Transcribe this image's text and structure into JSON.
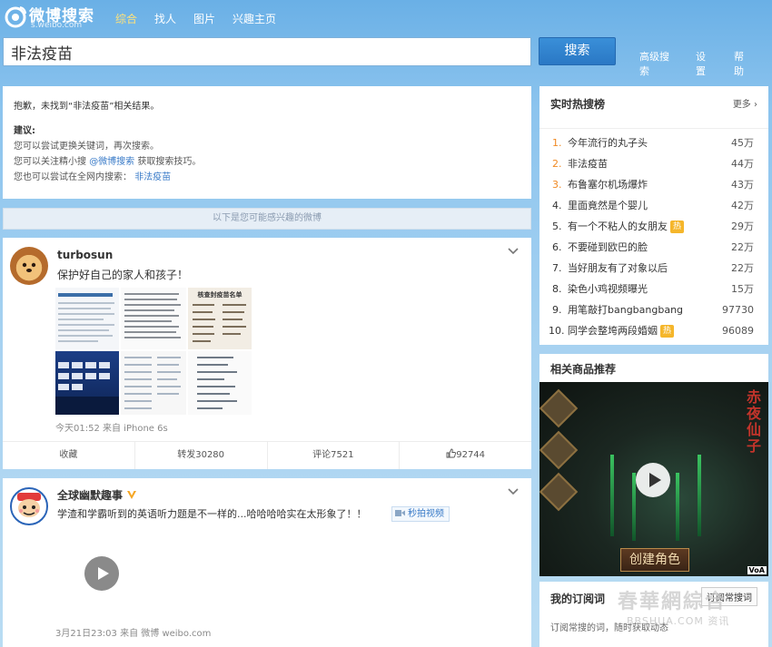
{
  "header": {
    "logo_text": "微博搜索",
    "logo_sub": "s.weibo.com",
    "tabs": [
      {
        "label": "综合",
        "active": true
      },
      {
        "label": "找人"
      },
      {
        "label": "图片"
      },
      {
        "label": "兴趣主页"
      }
    ],
    "search_value": "非法疫苗",
    "search_button": "搜索",
    "links": [
      "高级搜索",
      "设置",
      "帮助"
    ]
  },
  "no_result": {
    "line1_a": "抱歉，未找到“",
    "line1_q": "非法疫苗",
    "line1_b": "”相关结果。",
    "suggest_title": "建议:",
    "s1": "您可以尝试更换关键词，再次搜索。",
    "s2_a": "您可以关注精小搜",
    "s2_link": "@微博搜索",
    "s2_b": "获取搜索技巧。",
    "s3_a": "您也可以尝试在全网内搜索：",
    "s3_link": "非法疫苗"
  },
  "divider": "以下是您可能感兴趣的微博",
  "post1": {
    "user": "turbosun",
    "text": "保护好自己的家人和孩子！",
    "image_heading": "核查封疫苗名单",
    "meta": "今天01:52 来自 iPhone 6s",
    "actions": [
      "收藏",
      "转发30280",
      "评论7521",
      "92744"
    ]
  },
  "post2": {
    "user": "全球幽默趣事",
    "text": "学渣和学霸听到的英语听力题是不一样的...哈哈哈哈实在太形象了！！",
    "tag": "秒拍视频",
    "meta": "3月21日23:03 来自 微博 weibo.com"
  },
  "hot": {
    "title": "实时热搜榜",
    "more": "更多",
    "badge": "热",
    "items": [
      {
        "rank": "1.",
        "kw": "今年流行的丸子头",
        "cnt": "45万"
      },
      {
        "rank": "2.",
        "kw": "非法疫苗",
        "cnt": "44万"
      },
      {
        "rank": "3.",
        "kw": "布鲁塞尔机场爆炸",
        "cnt": "43万"
      },
      {
        "rank": "4.",
        "kw": "里面竟然是个婴儿",
        "cnt": "42万"
      },
      {
        "rank": "5.",
        "kw": "有一个不粘人的女朋友",
        "cnt": "29万"
      },
      {
        "rank": "6.",
        "kw": "不要碰到欧巴的脸",
        "cnt": "22万"
      },
      {
        "rank": "7.",
        "kw": "当好朋友有了对象以后",
        "cnt": "22万"
      },
      {
        "rank": "8.",
        "kw": "染色小鸡视频曝光",
        "cnt": "15万"
      },
      {
        "rank": "9.",
        "kw": "用笔敲打bangbangbang",
        "cnt": "97730"
      },
      {
        "rank": "10.",
        "kw": "同学会整垮两段婚姻",
        "cnt": "96089"
      }
    ]
  },
  "goods": {
    "title": "相关商品推荐",
    "game_title": "赤夜仙子",
    "cta": "创建角色",
    "voa": "VoA"
  },
  "subscribe": {
    "title": "我的订阅词",
    "button": "订阅常搜词",
    "text": "订阅常搜的词，随时获取动态"
  },
  "watermark": {
    "main": "春華網綜合",
    "sub": "BBSHUA.COM 资讯"
  }
}
